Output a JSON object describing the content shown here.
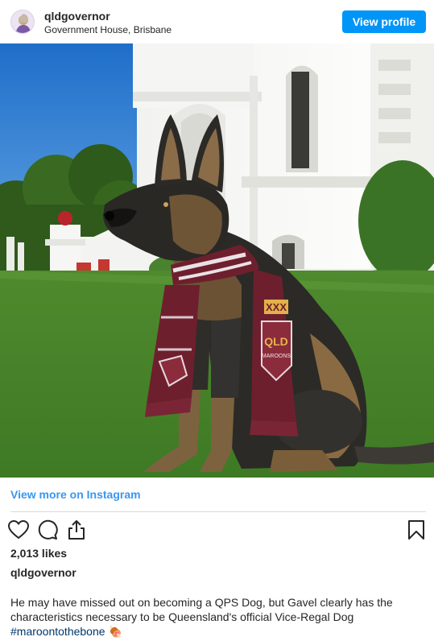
{
  "header": {
    "username": "qldgovernor",
    "location": "Government House, Brisbane",
    "view_profile_label": "View profile"
  },
  "view_more_label": "View more on Instagram",
  "likes_text": "2,013 likes",
  "caption": {
    "owner": "qldgovernor",
    "text": "He may have missed out on becoming a QPS Dog, but Gavel clearly has the characteristics necessary to be Queensland's official Vice-Regal Dog",
    "hashtag": "#maroontothebone",
    "emoji": "🍖"
  },
  "scarf_text": {
    "top": "XXX",
    "brand": "QLD",
    "sub": "MAROONS"
  },
  "icons": {
    "like": "heart-icon",
    "comment": "comment-icon",
    "share": "share-icon",
    "save": "bookmark-icon"
  },
  "colors": {
    "accent": "#0095f6",
    "link": "#3897f0",
    "hashtag": "#00376b",
    "maroon": "#6e1f2e"
  }
}
